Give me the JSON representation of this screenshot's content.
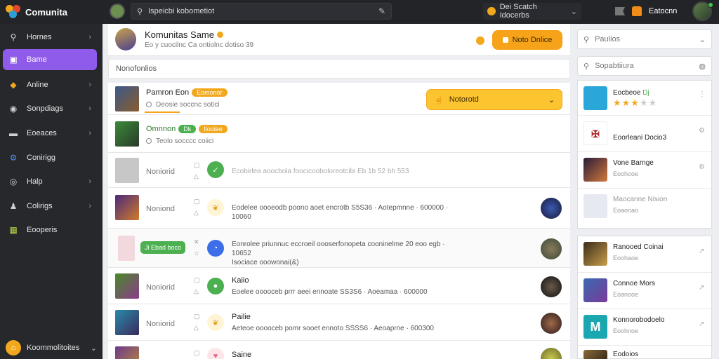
{
  "topbar": {
    "brand": "Comunita",
    "search_text": "Ispeicbi kobometiot",
    "mid_text": "Dei Scatch Idocerbs",
    "right_text": "Eatocnn"
  },
  "sidebar": {
    "items": [
      {
        "label": "Hornes",
        "icon": "search-icon"
      },
      {
        "label": "Bame",
        "icon": "gamepad-icon"
      },
      {
        "label": "Anline",
        "icon": "game-icon"
      },
      {
        "label": "Sonpdiags",
        "icon": "eye-icon"
      },
      {
        "label": "Eoeaces",
        "icon": "folder-icon"
      },
      {
        "label": "Conirigg",
        "icon": "settings-icon"
      },
      {
        "label": "Halp",
        "icon": "help-icon"
      },
      {
        "label": "Colirigs",
        "icon": "user-icon"
      },
      {
        "label": "Eooperis",
        "icon": "grid-icon"
      }
    ],
    "footer_label": "Koommolitoites"
  },
  "main": {
    "header_title": "Komunitas Same",
    "header_sub": "Eo y cuocilnc Ca ontiolnc dotiso 39",
    "header_button": "Noto Dnlice",
    "filter_text": "Nonofonlios",
    "rows": [
      {
        "name": "Pamron Eon",
        "tag": "Eomonor",
        "meta": "Deosie soccnc sotici",
        "select": "Notorotd"
      },
      {
        "name": "Omnnon",
        "tag1": "Dk",
        "tag2": "Ilooiee",
        "meta": "Teolo socccc coiici"
      },
      {
        "name": "Noniorid",
        "text": "Ecobirlea aoocbola foocicooboloreotcibi Eb 1b 52 bh 553"
      },
      {
        "name": "Noniond",
        "text": "Eodelee oooeodb poono aoet encrotb S5S36 · Aotepmnne · 600000 · 10060"
      },
      {
        "pill": "Ji Ebad boco",
        "text": "Eonrolee priunnuc eccroeil oooserfonopeta cooninelme 20 eoo egb · 10652",
        "text2": "Isociace ooowonai(&)"
      },
      {
        "name": "Noniorid",
        "title": "Kaiio",
        "text": "Eoelee ooooceb prrr aeei ennoate SS3S6 · Aoeamaa · 600000"
      },
      {
        "name": "Noniorid",
        "title": "Pailie",
        "text": "Aeteoe ooooceb pomr sooet ennoto SSSS6 · Aeoaprne · 600300"
      },
      {
        "name": "Noniorid",
        "title": "Saine"
      }
    ]
  },
  "right": {
    "input1": "Paulios",
    "input2": "Sopabtiiura",
    "card1": [
      {
        "title": "Eocbeoe",
        "title_accent": "Dj"
      },
      {
        "title": "Eoorleani Docio3"
      },
      {
        "title": "Vone Barnge",
        "sub": "Eoohooe"
      },
      {
        "title": "Maocanne Nision",
        "sub": "Eoaonao"
      }
    ],
    "card2": [
      {
        "title": "Ranooed Coinai",
        "sub": "Eoohaoe"
      },
      {
        "title": "Connoe Mors",
        "sub": "Eoanooe"
      },
      {
        "title": "Konnorobodoelo",
        "sub": "Eoohnoe"
      },
      {
        "title": "Eodoios"
      }
    ]
  },
  "colors": {
    "accent": "#8f5bea",
    "orange": "#f7a31a",
    "yellow": "#fcc42f",
    "green": "#4caf50"
  }
}
